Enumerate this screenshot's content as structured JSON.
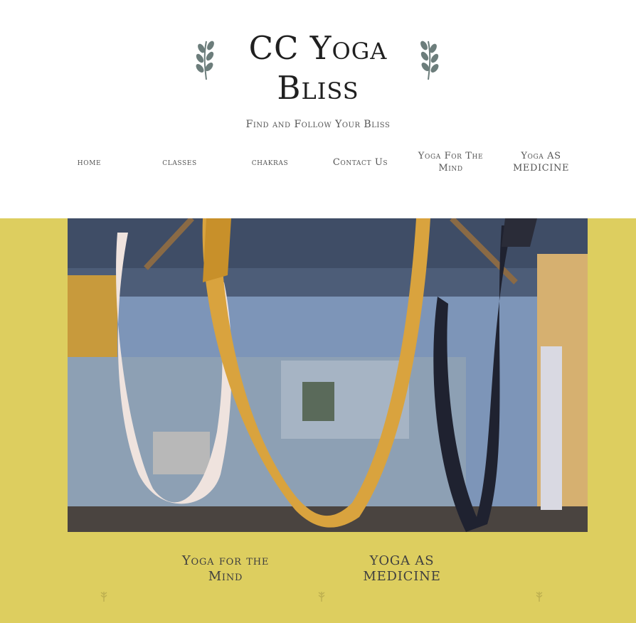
{
  "site": {
    "title": "CC Yoga Bliss",
    "tagline": "Find and Follow Your Bliss"
  },
  "nav": {
    "items": [
      {
        "label": "home"
      },
      {
        "label": "classes"
      },
      {
        "label": "chakras"
      },
      {
        "label": "Contact Us"
      },
      {
        "label": "Yoga For The Mind"
      },
      {
        "label": "Yoga AS MEDICINE"
      }
    ]
  },
  "hero": {
    "icon": "aerial-yoga-studio-photo"
  },
  "cards": [
    {
      "title": "Yoga for the Mind"
    },
    {
      "title": "YOGA AS MEDICINE"
    }
  ],
  "colors": {
    "band": "#ddce5f",
    "title": "#1f1f1f",
    "nav": "#555555",
    "laurel": "#6c7d7b"
  }
}
